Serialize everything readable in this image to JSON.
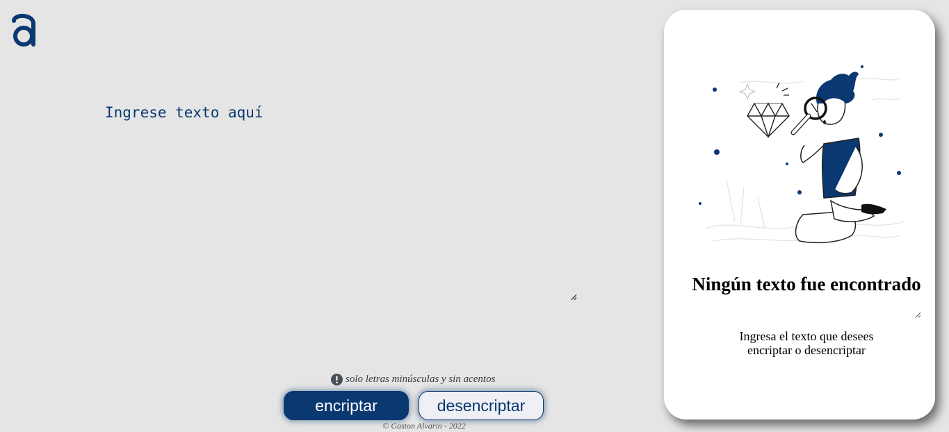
{
  "brand": {
    "logo_icon": "alura-a-logo-icon",
    "accent_color": "#0a3871"
  },
  "editor": {
    "placeholder": "Ingrese texto aquí"
  },
  "hint": {
    "icon": "exclamation-circle-icon",
    "text": "solo letras minúsculas y sin acentos"
  },
  "actions": {
    "encrypt_label": "encriptar",
    "decrypt_label": "desencriptar"
  },
  "footer": {
    "text": "© Gaston Alvarin - 2022"
  },
  "result_panel": {
    "illustration": "person-with-magnifying-glass-illustration",
    "title": "Ningún texto fue encontrado",
    "subtitle": "Ingresa el texto que desees encriptar o desencriptar"
  }
}
